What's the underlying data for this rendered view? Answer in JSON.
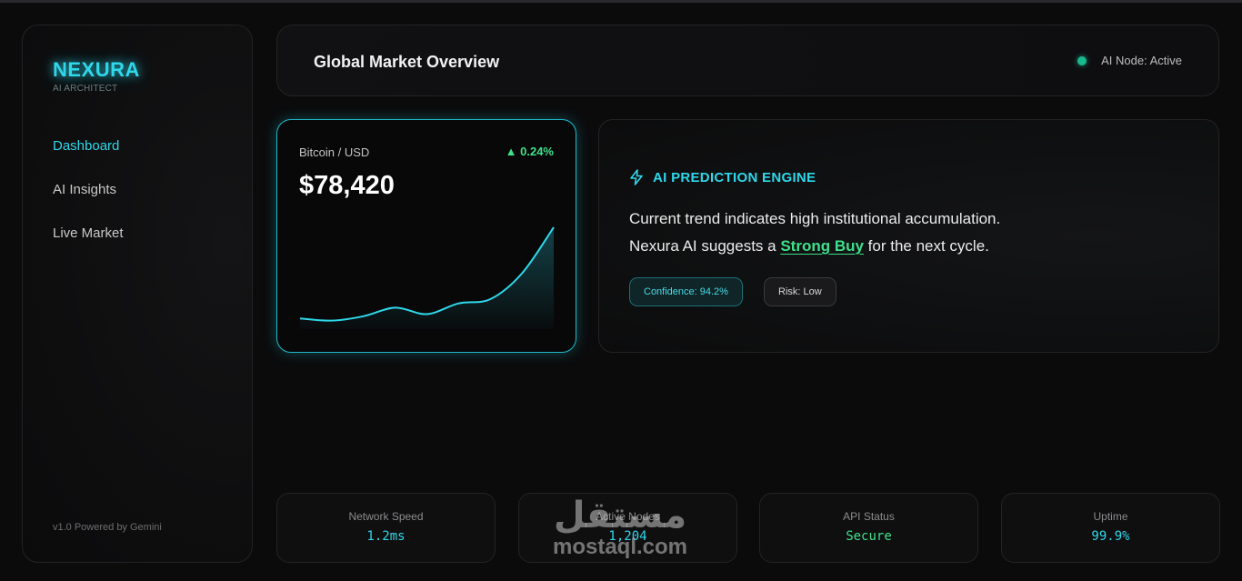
{
  "sidebar": {
    "brand": "NEXURA",
    "brand_sub": "AI ARCHITECT",
    "items": [
      {
        "label": "Dashboard"
      },
      {
        "label": "AI Insights"
      },
      {
        "label": "Live Market"
      }
    ],
    "footer": "v1.0 Powered by Gemini"
  },
  "header": {
    "title": "Global Market Overview",
    "status": "AI Node: Active"
  },
  "btc": {
    "pair": "Bitcoin / USD",
    "change": "▲ 0.24%",
    "price": "$78,420"
  },
  "chart_data": {
    "type": "area",
    "values": [
      10,
      8,
      12,
      20,
      14,
      24,
      28,
      52,
      95
    ],
    "color": "#2fd7ea"
  },
  "ai": {
    "title": "AI PREDICTION ENGINE",
    "line1": "Current trend indicates high institutional accumulation.",
    "line2_prefix": "Nexura AI suggests a ",
    "line2_highlight": "Strong Buy",
    "line2_suffix": " for the next cycle.",
    "confidence": "Confidence: 94.2%",
    "risk": "Risk: Low"
  },
  "stats": [
    {
      "label": "Network Speed",
      "value": "1.2ms"
    },
    {
      "label": "Active Nodes",
      "value": "1,204"
    },
    {
      "label": "API Status",
      "value": "Secure"
    },
    {
      "label": "Uptime",
      "value": "99.9%"
    }
  ],
  "watermark": {
    "arabic": "مستقل",
    "latin": "mostaql.com"
  },
  "colors": {
    "accent": "#2fd7ea",
    "positive": "#3ee08b",
    "status_dot": "#18b98d"
  }
}
